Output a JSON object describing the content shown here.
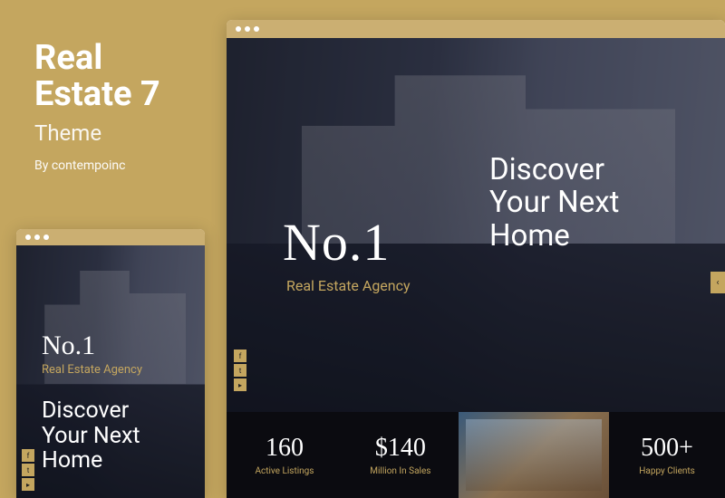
{
  "info": {
    "title_line1": "Real",
    "title_line2": "Estate 7",
    "subtitle": "Theme",
    "byline": "By contempoinc"
  },
  "hero": {
    "no1": "No.1",
    "agency": "Real Estate Agency",
    "headline_l1": "Discover",
    "headline_l2": "Your Next",
    "headline_l3": "Home"
  },
  "socials": {
    "facebook": "f",
    "twitter": "t",
    "youtube": "▸"
  },
  "nav": {
    "prev": "‹"
  },
  "stats": {
    "s1": {
      "num": "160",
      "lbl": "Active Listings"
    },
    "s2": {
      "num": "$140",
      "lbl": "Million In Sales"
    },
    "s3": {
      "num": "500+",
      "lbl": "Happy Clients"
    }
  }
}
